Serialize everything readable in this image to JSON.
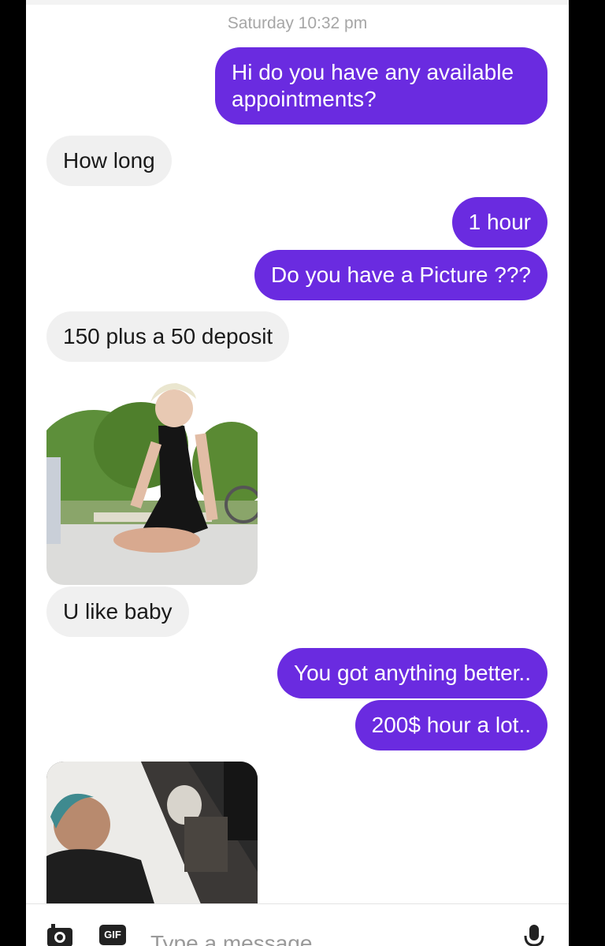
{
  "conversation": {
    "timestamp": "Saturday 10:32 pm",
    "messages": [
      {
        "sender": "me",
        "text": "Hi do you have any available appointments?"
      },
      {
        "sender": "them",
        "text": "How long"
      },
      {
        "sender": "me",
        "text": "1 hour"
      },
      {
        "sender": "me",
        "text": "Do you have a Picture ???"
      },
      {
        "sender": "them",
        "text": "150 plus a 50 deposit"
      },
      {
        "sender": "them",
        "type": "photo"
      },
      {
        "sender": "them",
        "text": "U like baby"
      },
      {
        "sender": "me",
        "text": "You got anything better.."
      },
      {
        "sender": "me",
        "text": "200$ hour a lot.."
      },
      {
        "sender": "them",
        "type": "photo"
      }
    ]
  },
  "composer": {
    "camera_icon": "camera-icon",
    "gif_label": "GIF",
    "placeholder": "Type a message",
    "mic_icon": "microphone-icon"
  },
  "colors": {
    "outgoing_bubble": "#6a2be0",
    "incoming_bubble": "#f0f0f0",
    "timestamp": "#a6a6a6"
  }
}
